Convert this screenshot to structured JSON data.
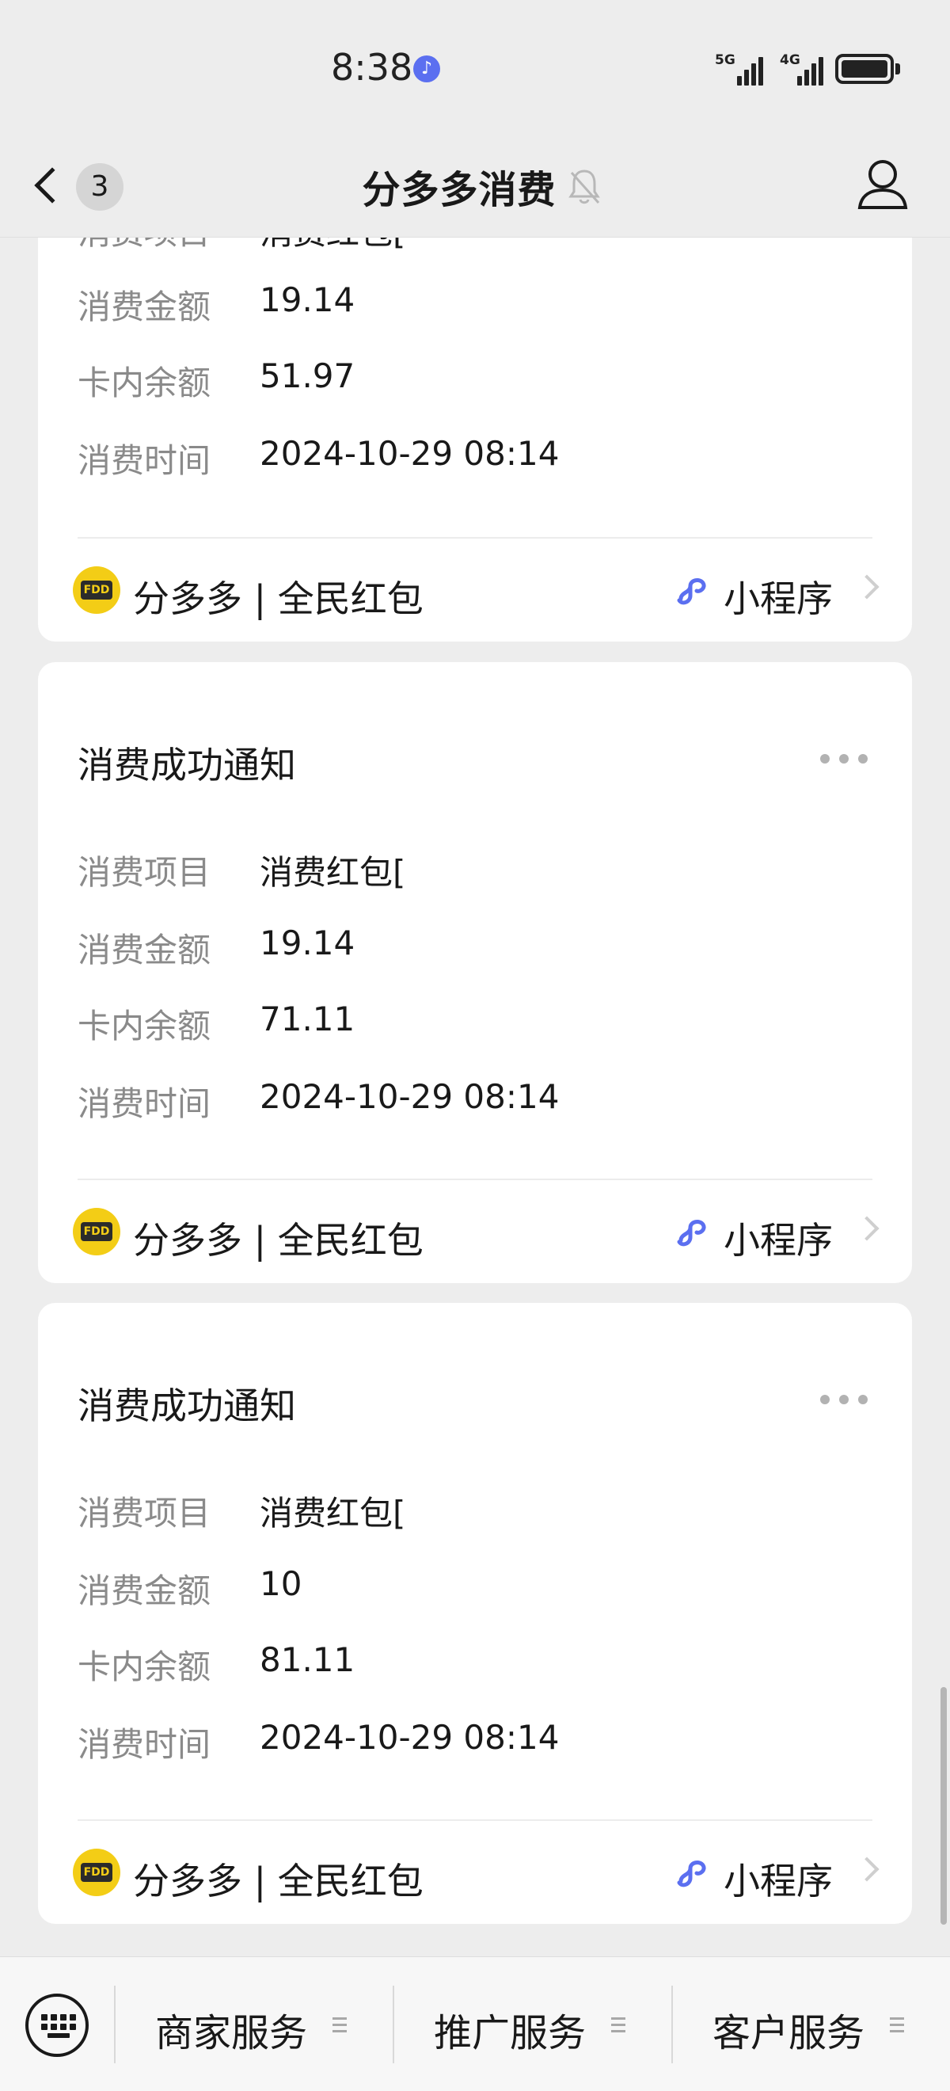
{
  "status": {
    "time": "8:38",
    "net1": "5G",
    "net2": "4G"
  },
  "header": {
    "unread_count": "3",
    "title": "分多多消费"
  },
  "labels": {
    "item": "消费项目",
    "amount": "消费金额",
    "balance": "卡内余额",
    "time": "消费时间"
  },
  "cards": [
    {
      "partial_label": "消费项目",
      "partial_value": "消费红包[",
      "amount": "19.14",
      "balance": "51.97",
      "time": "2024-10-29 08:14",
      "brand": "分多多 | 全民红包",
      "mini_program": "小程序"
    },
    {
      "title": "消费成功通知",
      "item": "消费红包[",
      "amount": "19.14",
      "balance": "71.11",
      "time": "2024-10-29 08:14",
      "brand": "分多多 | 全民红包",
      "mini_program": "小程序"
    },
    {
      "title": "消费成功通知",
      "item": "消费红包[",
      "amount": "10",
      "balance": "81.11",
      "time": "2024-10-29 08:14",
      "brand": "分多多 | 全民红包",
      "mini_program": "小程序"
    }
  ],
  "menu": [
    {
      "label": "商家服务"
    },
    {
      "label": "推广服务"
    },
    {
      "label": "客户服务"
    }
  ],
  "colors": {
    "background": "#ededed",
    "card": "#ffffff",
    "brand_yellow": "#f3cd16",
    "mini_program_blue": "#5b6ff0"
  }
}
